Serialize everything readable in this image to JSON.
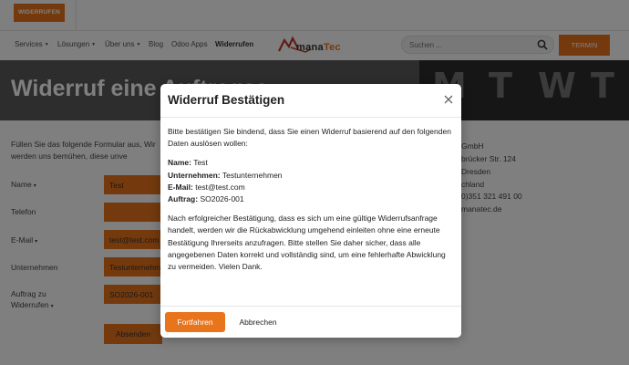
{
  "topbar": {
    "widerrufen_label": "WIDERRUFEN"
  },
  "nav": {
    "items": [
      "Services",
      "Lösungen",
      "Über uns",
      "Blog",
      "Odoo Apps",
      "Widerrufen"
    ],
    "logo_text_a": "mana",
    "logo_text_b": "Tec",
    "search_placeholder": "Suchen ...",
    "termin_label": "TERMIN"
  },
  "hero": {
    "title": "Widerruf eine  Auftrages",
    "letters": [
      "M",
      "T",
      "W",
      "T"
    ]
  },
  "form": {
    "intro": "Füllen Sie das folgende Formular aus, Wir werden uns bemühen, diese unve",
    "labels": {
      "name": "Name",
      "telefon": "Telefon",
      "email": "E-Mail",
      "unternehmen": "Unternehmen",
      "auftrag_line1": "Auftrag zu",
      "auftrag_line2": "Widerrufen"
    },
    "values": {
      "name": "Test",
      "telefon": "",
      "email": "test@test.com",
      "unternehmen": "Testunternehmen",
      "auftrag": "SO2026-001"
    },
    "submit_label": "Absenden"
  },
  "contact": {
    "lines": [
      "GmbH",
      "brücker Str. 124",
      "Dresden",
      "chland",
      "0)351 321 491 00",
      "manatec.de"
    ]
  },
  "modal": {
    "title": "Widerruf Bestätigen",
    "intro": "Bitte bestätigen Sie bindend, dass Sie einen Widerruf basierend auf den folgenden Daten auslösen wollen:",
    "fields": [
      {
        "label": "Name:",
        "value": "Test"
      },
      {
        "label": "Unternehmen:",
        "value": "Testunternehmen"
      },
      {
        "label": "E-Mail:",
        "value": "test@test.com"
      },
      {
        "label": "Auftrag:",
        "value": "SO2026-001"
      }
    ],
    "notice": "Nach erfolgreicher Bestätigung, dass es sich um eine gültige Widerrufsanfrage handelt, werden wir die Rückabwicklung umgehend einleiten ohne eine erneute Bestätigung Ihrerseits anzufragen. Bitte stellen Sie daher sicher, dass alle angegebenen Daten korrekt und vollständig sind, um eine fehlerhafte Abwicklung zu vermeiden. Vielen Dank.",
    "confirm_label": "Fortfahren",
    "cancel_label": "Abbrechen"
  },
  "colors": {
    "accent": "#e8741c",
    "overlay": "rgba(0,0,0,0.5)"
  }
}
